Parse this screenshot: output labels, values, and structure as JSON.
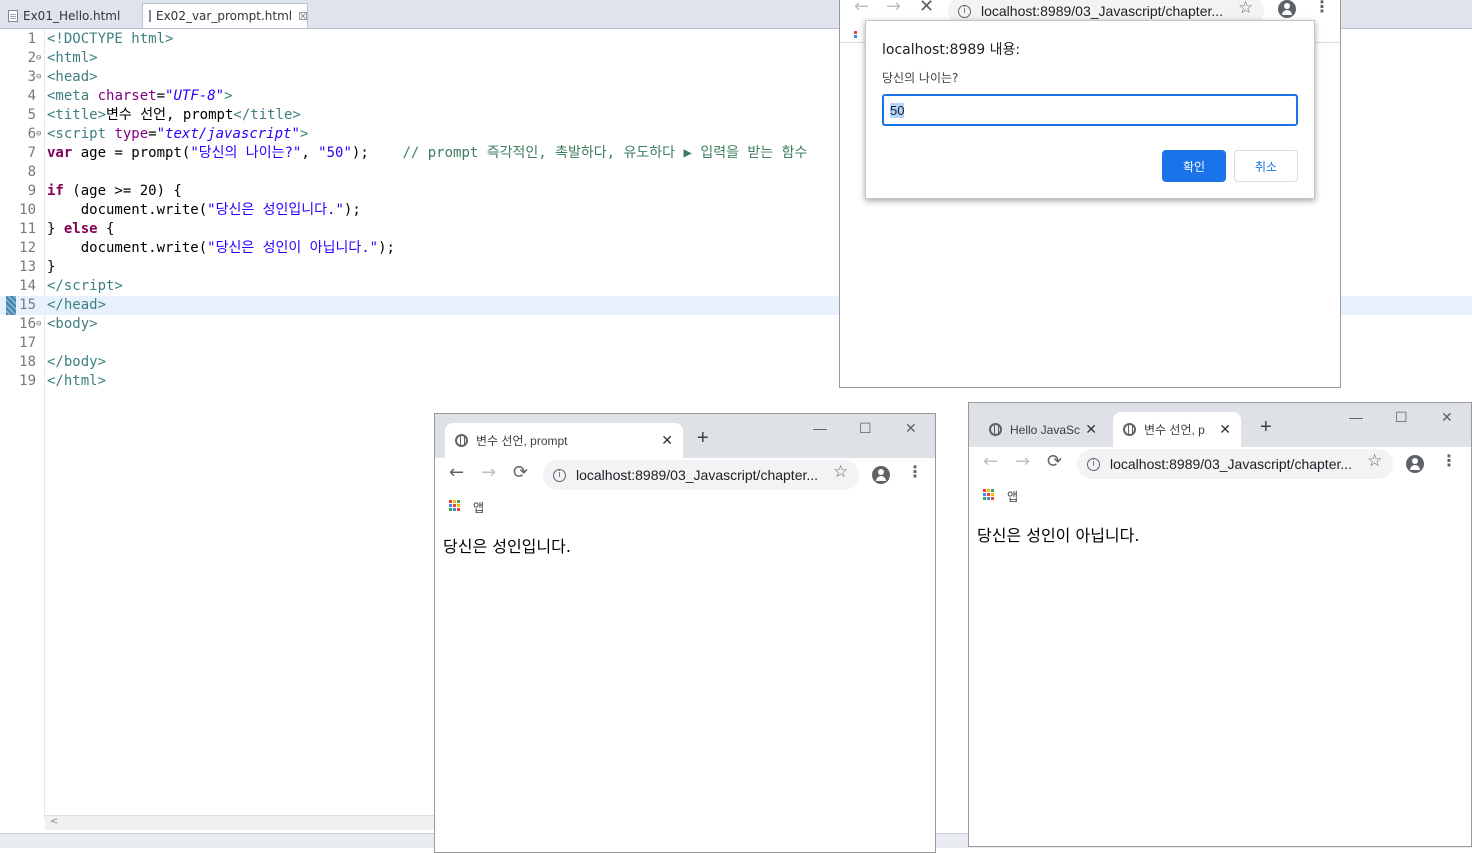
{
  "editor": {
    "tabs": [
      {
        "label": "Ex01_Hello.html"
      },
      {
        "label": "Ex02_var_prompt.html",
        "close": "☒"
      }
    ],
    "lines": [
      {
        "num": "1",
        "html": "<span class='tg'>&lt;!DOCTYPE html&gt;</span>"
      },
      {
        "num": "2",
        "fold": "⊖",
        "html": "<span class='tg'>&lt;html&gt;</span>"
      },
      {
        "num": "3",
        "fold": "⊖",
        "html": "<span class='tg'>&lt;head&gt;</span>"
      },
      {
        "num": "4",
        "html": "<span class='tg'>&lt;meta</span> <span class='at'>charset</span>=<span class='av'>\"UTF-8\"</span><span class='tg'>&gt;</span>"
      },
      {
        "num": "5",
        "html": "<span class='tg'>&lt;title&gt;</span>변수 선언, prompt<span class='tg'>&lt;/title&gt;</span>"
      },
      {
        "num": "6",
        "fold": "⊖",
        "html": "<span class='tg'>&lt;script</span> <span class='at'>type</span>=<span class='av'>\"text/javascript\"</span><span class='tg'>&gt;</span>"
      },
      {
        "num": "7",
        "html": "<span class='k'>var</span> age = prompt(<span class='s'>\"당신의 나이는?\"</span>, <span class='s'>\"50\"</span>);    <span class='cm'>// prompt 즉각적인, 촉발하다, 유도하다 ▶ 입력을 받는 함수</span>"
      },
      {
        "num": "8",
        "html": ""
      },
      {
        "num": "9",
        "html": "<span class='k'>if</span> (age &gt;= 20) {"
      },
      {
        "num": "10",
        "html": "    document.write(<span class='s'>\"당신은 성인입니다.\"</span>);"
      },
      {
        "num": "11",
        "html": "} <span class='k'>else</span> {"
      },
      {
        "num": "12",
        "html": "    document.write(<span class='s'>\"당신은 성인이 아닙니다.\"</span>);"
      },
      {
        "num": "13",
        "html": "}"
      },
      {
        "num": "14",
        "html": "<span class='tg'>&lt;/script&gt;</span>"
      },
      {
        "num": "15",
        "html": "<span class='tg'>&lt;/head&gt;</span>",
        "highlight": true
      },
      {
        "num": "16",
        "fold": "⊖",
        "html": "<span class='tg'>&lt;body&gt;</span>"
      },
      {
        "num": "17",
        "html": ""
      },
      {
        "num": "18",
        "html": "<span class='tg'>&lt;/body&gt;</span>"
      },
      {
        "num": "19",
        "html": "<span class='tg'>&lt;/html&gt;</span>"
      }
    ],
    "scroll_left": "<"
  },
  "browser_top": {
    "url": "localhost:8989/03_Javascript/chapter...",
    "icons": {
      "back": "←",
      "forward": "→",
      "stop": "✕",
      "star": "☆",
      "menu": "⋮"
    }
  },
  "dialog": {
    "title": "localhost:8989 내용:",
    "message": "당신의 나이는?",
    "input_value": "50",
    "ok_label": "확인",
    "cancel_label": "취소",
    "accent": "#1a73e8"
  },
  "browser_mid": {
    "tab_label": "변수 선언, prompt",
    "tab_close": "✕",
    "new_tab": "+",
    "win_min": "—",
    "win_max": "☐",
    "win_close": "✕",
    "url": "localhost:8989/03_Javascript/chapter...",
    "bookmark_label": "앱",
    "page_text": "당신은 성인입니다."
  },
  "browser_right": {
    "tab1_label": "Hello JavaSc",
    "tab2_label": "변수 선언, p",
    "tab_close": "✕",
    "new_tab": "+",
    "win_min": "—",
    "win_max": "☐",
    "win_close": "✕",
    "url": "localhost:8989/03_Javascript/chapter...",
    "bookmark_label": "앱",
    "page_text": "당신은 성인이 아닙니다."
  },
  "nav_icons": {
    "back": "←",
    "forward": "→",
    "reload": "⟳",
    "star": "☆",
    "menu": "⋮",
    "info": "i"
  }
}
